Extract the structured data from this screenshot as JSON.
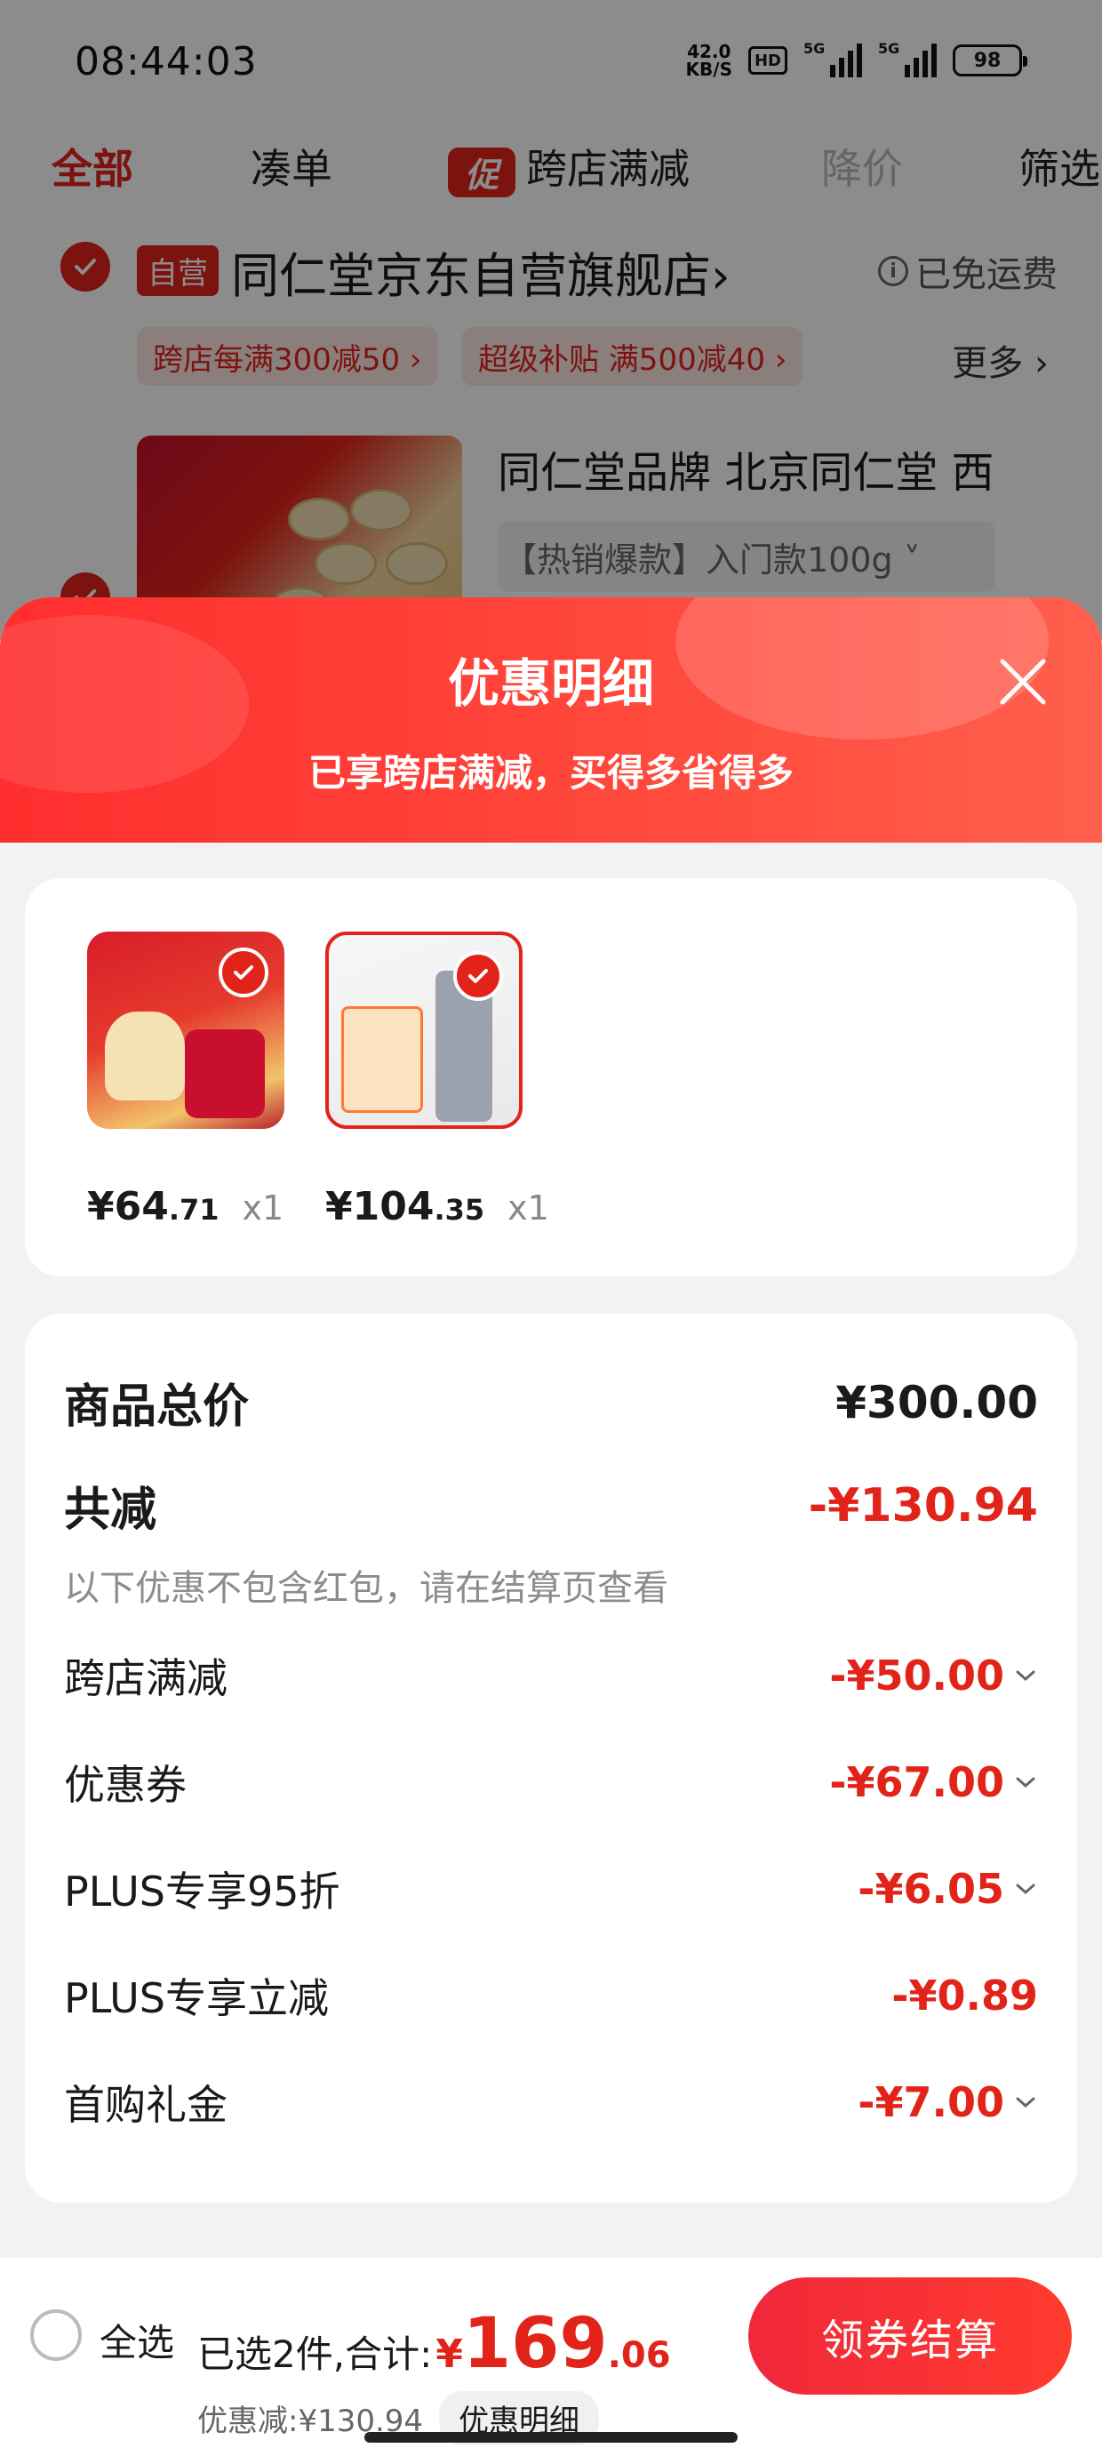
{
  "status_bar": {
    "time": "08:44:03",
    "net_speed_value": "42.0",
    "net_speed_unit": "KB/S",
    "hd_label": "HD",
    "signal_1_label": "5G",
    "signal_2_label": "5G",
    "battery": "98"
  },
  "filter_tabs": [
    {
      "label": "全部",
      "state": "active"
    },
    {
      "label": "凑单",
      "state": "normal"
    },
    {
      "label": "跨店满减",
      "state": "normal",
      "badge": "促"
    },
    {
      "label": "降价",
      "state": "disabled"
    },
    {
      "label": "筛选",
      "state": "normal"
    }
  ],
  "store": {
    "tag": "自营",
    "name": "同仁堂京东自营旗舰店",
    "name_arrow": "›",
    "shipping": "已免运费",
    "promo_chips": [
      "跨店每满300减50 ›",
      "超级补贴 满500减40 ›"
    ],
    "more_label": "更多 ›",
    "product_title": "同仁堂品牌 北京同仁堂 西",
    "product_spec": "【热销爆款】入门款100g ˅"
  },
  "sheet": {
    "title": "优惠明细",
    "subtitle": "已享跨店满减，买得多省得多",
    "items": [
      {
        "price_int": "¥64",
        "price_dec": ".71",
        "qty": "x1"
      },
      {
        "price_int": "¥104",
        "price_dec": ".35",
        "qty": "x1"
      }
    ],
    "summary": {
      "total_label": "商品总价",
      "total_value": "¥300.00",
      "reduction_label": "共减",
      "reduction_value": "-¥130.94",
      "note": "以下优惠不包含红包，请在结算页查看",
      "rows": [
        {
          "label": "跨店满减",
          "value": "-¥50.00",
          "expandable": true
        },
        {
          "label": "优惠券",
          "value": "-¥67.00",
          "expandable": true
        },
        {
          "label": "PLUS专享95折",
          "value": "-¥6.05",
          "expandable": true
        },
        {
          "label": "PLUS专享立减",
          "value": "-¥0.89",
          "expandable": false
        },
        {
          "label": "首购礼金",
          "value": "-¥7.00",
          "expandable": true
        }
      ]
    }
  },
  "bottom_bar": {
    "select_all": "全选",
    "selected_prefix": "已选2件,合计:",
    "total_currency": "¥",
    "total_int": "169",
    "total_dec": ".06",
    "discount_text": "优惠减:¥130.94",
    "detail_button": "优惠明细",
    "checkout_button": "领券结算"
  },
  "colors": {
    "accent": "#e2231a",
    "header_gradient_start": "#ff2e2e",
    "header_gradient_end": "#ff5f4e"
  }
}
